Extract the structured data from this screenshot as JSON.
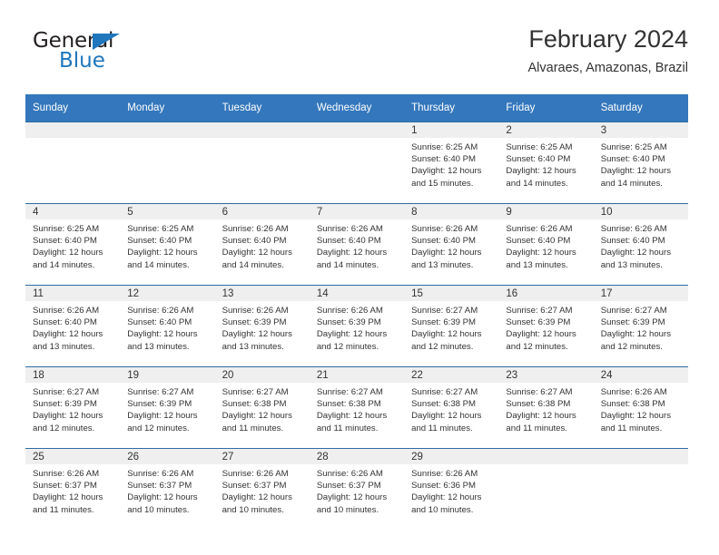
{
  "brand": {
    "name_top": "General",
    "name_bottom": "Blue",
    "triangle_color": "#1f76bc"
  },
  "header": {
    "title": "February 2024",
    "subtitle": "Alvaraes, Amazonas, Brazil"
  },
  "theme": {
    "header_blue": "#3477bc",
    "rule_blue": "#2e6da4",
    "band_gray": "#efefef",
    "text": "#333333"
  },
  "weekday_headers": [
    "Sunday",
    "Monday",
    "Tuesday",
    "Wednesday",
    "Thursday",
    "Friday",
    "Saturday"
  ],
  "weeks": [
    [
      {
        "day": "",
        "empty": true,
        "sunrise": "",
        "sunset": "",
        "daylight_line1": "",
        "daylight_line2": ""
      },
      {
        "day": "",
        "empty": true,
        "sunrise": "",
        "sunset": "",
        "daylight_line1": "",
        "daylight_line2": ""
      },
      {
        "day": "",
        "empty": true,
        "sunrise": "",
        "sunset": "",
        "daylight_line1": "",
        "daylight_line2": ""
      },
      {
        "day": "",
        "empty": true,
        "sunrise": "",
        "sunset": "",
        "daylight_line1": "",
        "daylight_line2": ""
      },
      {
        "day": "1",
        "empty": false,
        "sunrise": "Sunrise: 6:25 AM",
        "sunset": "Sunset: 6:40 PM",
        "daylight_line1": "Daylight: 12 hours",
        "daylight_line2": "and 15 minutes."
      },
      {
        "day": "2",
        "empty": false,
        "sunrise": "Sunrise: 6:25 AM",
        "sunset": "Sunset: 6:40 PM",
        "daylight_line1": "Daylight: 12 hours",
        "daylight_line2": "and 14 minutes."
      },
      {
        "day": "3",
        "empty": false,
        "sunrise": "Sunrise: 6:25 AM",
        "sunset": "Sunset: 6:40 PM",
        "daylight_line1": "Daylight: 12 hours",
        "daylight_line2": "and 14 minutes."
      }
    ],
    [
      {
        "day": "4",
        "empty": false,
        "sunrise": "Sunrise: 6:25 AM",
        "sunset": "Sunset: 6:40 PM",
        "daylight_line1": "Daylight: 12 hours",
        "daylight_line2": "and 14 minutes."
      },
      {
        "day": "5",
        "empty": false,
        "sunrise": "Sunrise: 6:25 AM",
        "sunset": "Sunset: 6:40 PM",
        "daylight_line1": "Daylight: 12 hours",
        "daylight_line2": "and 14 minutes."
      },
      {
        "day": "6",
        "empty": false,
        "sunrise": "Sunrise: 6:26 AM",
        "sunset": "Sunset: 6:40 PM",
        "daylight_line1": "Daylight: 12 hours",
        "daylight_line2": "and 14 minutes."
      },
      {
        "day": "7",
        "empty": false,
        "sunrise": "Sunrise: 6:26 AM",
        "sunset": "Sunset: 6:40 PM",
        "daylight_line1": "Daylight: 12 hours",
        "daylight_line2": "and 14 minutes."
      },
      {
        "day": "8",
        "empty": false,
        "sunrise": "Sunrise: 6:26 AM",
        "sunset": "Sunset: 6:40 PM",
        "daylight_line1": "Daylight: 12 hours",
        "daylight_line2": "and 13 minutes."
      },
      {
        "day": "9",
        "empty": false,
        "sunrise": "Sunrise: 6:26 AM",
        "sunset": "Sunset: 6:40 PM",
        "daylight_line1": "Daylight: 12 hours",
        "daylight_line2": "and 13 minutes."
      },
      {
        "day": "10",
        "empty": false,
        "sunrise": "Sunrise: 6:26 AM",
        "sunset": "Sunset: 6:40 PM",
        "daylight_line1": "Daylight: 12 hours",
        "daylight_line2": "and 13 minutes."
      }
    ],
    [
      {
        "day": "11",
        "empty": false,
        "sunrise": "Sunrise: 6:26 AM",
        "sunset": "Sunset: 6:40 PM",
        "daylight_line1": "Daylight: 12 hours",
        "daylight_line2": "and 13 minutes."
      },
      {
        "day": "12",
        "empty": false,
        "sunrise": "Sunrise: 6:26 AM",
        "sunset": "Sunset: 6:40 PM",
        "daylight_line1": "Daylight: 12 hours",
        "daylight_line2": "and 13 minutes."
      },
      {
        "day": "13",
        "empty": false,
        "sunrise": "Sunrise: 6:26 AM",
        "sunset": "Sunset: 6:39 PM",
        "daylight_line1": "Daylight: 12 hours",
        "daylight_line2": "and 13 minutes."
      },
      {
        "day": "14",
        "empty": false,
        "sunrise": "Sunrise: 6:26 AM",
        "sunset": "Sunset: 6:39 PM",
        "daylight_line1": "Daylight: 12 hours",
        "daylight_line2": "and 12 minutes."
      },
      {
        "day": "15",
        "empty": false,
        "sunrise": "Sunrise: 6:27 AM",
        "sunset": "Sunset: 6:39 PM",
        "daylight_line1": "Daylight: 12 hours",
        "daylight_line2": "and 12 minutes."
      },
      {
        "day": "16",
        "empty": false,
        "sunrise": "Sunrise: 6:27 AM",
        "sunset": "Sunset: 6:39 PM",
        "daylight_line1": "Daylight: 12 hours",
        "daylight_line2": "and 12 minutes."
      },
      {
        "day": "17",
        "empty": false,
        "sunrise": "Sunrise: 6:27 AM",
        "sunset": "Sunset: 6:39 PM",
        "daylight_line1": "Daylight: 12 hours",
        "daylight_line2": "and 12 minutes."
      }
    ],
    [
      {
        "day": "18",
        "empty": false,
        "sunrise": "Sunrise: 6:27 AM",
        "sunset": "Sunset: 6:39 PM",
        "daylight_line1": "Daylight: 12 hours",
        "daylight_line2": "and 12 minutes."
      },
      {
        "day": "19",
        "empty": false,
        "sunrise": "Sunrise: 6:27 AM",
        "sunset": "Sunset: 6:39 PM",
        "daylight_line1": "Daylight: 12 hours",
        "daylight_line2": "and 12 minutes."
      },
      {
        "day": "20",
        "empty": false,
        "sunrise": "Sunrise: 6:27 AM",
        "sunset": "Sunset: 6:38 PM",
        "daylight_line1": "Daylight: 12 hours",
        "daylight_line2": "and 11 minutes."
      },
      {
        "day": "21",
        "empty": false,
        "sunrise": "Sunrise: 6:27 AM",
        "sunset": "Sunset: 6:38 PM",
        "daylight_line1": "Daylight: 12 hours",
        "daylight_line2": "and 11 minutes."
      },
      {
        "day": "22",
        "empty": false,
        "sunrise": "Sunrise: 6:27 AM",
        "sunset": "Sunset: 6:38 PM",
        "daylight_line1": "Daylight: 12 hours",
        "daylight_line2": "and 11 minutes."
      },
      {
        "day": "23",
        "empty": false,
        "sunrise": "Sunrise: 6:27 AM",
        "sunset": "Sunset: 6:38 PM",
        "daylight_line1": "Daylight: 12 hours",
        "daylight_line2": "and 11 minutes."
      },
      {
        "day": "24",
        "empty": false,
        "sunrise": "Sunrise: 6:26 AM",
        "sunset": "Sunset: 6:38 PM",
        "daylight_line1": "Daylight: 12 hours",
        "daylight_line2": "and 11 minutes."
      }
    ],
    [
      {
        "day": "25",
        "empty": false,
        "sunrise": "Sunrise: 6:26 AM",
        "sunset": "Sunset: 6:37 PM",
        "daylight_line1": "Daylight: 12 hours",
        "daylight_line2": "and 11 minutes."
      },
      {
        "day": "26",
        "empty": false,
        "sunrise": "Sunrise: 6:26 AM",
        "sunset": "Sunset: 6:37 PM",
        "daylight_line1": "Daylight: 12 hours",
        "daylight_line2": "and 10 minutes."
      },
      {
        "day": "27",
        "empty": false,
        "sunrise": "Sunrise: 6:26 AM",
        "sunset": "Sunset: 6:37 PM",
        "daylight_line1": "Daylight: 12 hours",
        "daylight_line2": "and 10 minutes."
      },
      {
        "day": "28",
        "empty": false,
        "sunrise": "Sunrise: 6:26 AM",
        "sunset": "Sunset: 6:37 PM",
        "daylight_line1": "Daylight: 12 hours",
        "daylight_line2": "and 10 minutes."
      },
      {
        "day": "29",
        "empty": false,
        "sunrise": "Sunrise: 6:26 AM",
        "sunset": "Sunset: 6:36 PM",
        "daylight_line1": "Daylight: 12 hours",
        "daylight_line2": "and 10 minutes."
      },
      {
        "day": "",
        "empty": true,
        "sunrise": "",
        "sunset": "",
        "daylight_line1": "",
        "daylight_line2": ""
      },
      {
        "day": "",
        "empty": true,
        "sunrise": "",
        "sunset": "",
        "daylight_line1": "",
        "daylight_line2": ""
      }
    ]
  ]
}
